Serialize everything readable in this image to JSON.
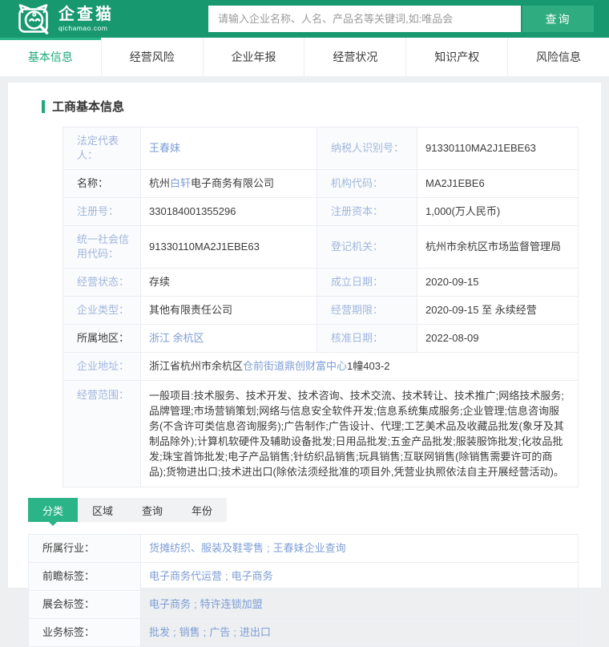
{
  "header": {
    "logo_title": "企查猫",
    "logo_subtitle": "qichamao.com",
    "search_placeholder": "请输入企业名称、人名、产品名等关键词,如:唯品会",
    "search_value": "",
    "search_button": "查询"
  },
  "nav": {
    "tabs": [
      {
        "label": "基本信息",
        "active": true
      },
      {
        "label": "经营风险",
        "active": false
      },
      {
        "label": "企业年报",
        "active": false
      },
      {
        "label": "经营状况",
        "active": false
      },
      {
        "label": "知识产权",
        "active": false
      },
      {
        "label": "风险信息",
        "active": false
      }
    ]
  },
  "section_title": "工商基本信息",
  "info": {
    "rows": [
      {
        "l1": "法定代表人：",
        "v1": "王春妹",
        "l2": "纳税人识别号：",
        "v2": "91330110MA2J1EBE63"
      },
      {
        "l1": "名称：",
        "v1_prefix": "杭州",
        "v1_highlight": "白轩",
        "v1_suffix": "电子商务有限公司",
        "l2": "机构代码：",
        "v2": "MA2J1EBE6"
      },
      {
        "l1": "注册号：",
        "v1": "330184001355296",
        "l2": "注册资本：",
        "v2": "1,000(万人民币)"
      },
      {
        "l1": "统一社会信用代码：",
        "v1": "91330110MA2J1EBE63",
        "l2": "登记机关：",
        "v2": "杭州市余杭区市场监督管理局"
      },
      {
        "l1": "经营状态：",
        "v1": "存续",
        "l2": "成立日期：",
        "v2": "2020-09-15"
      },
      {
        "l1": "企业类型：",
        "v1": "其他有限责任公司",
        "l2": "经营期限：",
        "v2": "2020-09-15 至 永续经营"
      },
      {
        "l1": "所属地区：",
        "v1": "浙江 余杭区",
        "l2": "核准日期：",
        "v2": "2022-08-09"
      }
    ],
    "address": {
      "label": "企业地址：",
      "prefix": "浙江省杭州市余杭区",
      "link": "仓前街道鼎创财富中心",
      "suffix": "1幢403-2"
    },
    "scope": {
      "label": "经营范围：",
      "text": "一般项目:技术服务、技术开发、技术咨询、技术交流、技术转让、技术推广;网络技术服务;品牌管理;市场营销策划;网络与信息安全软件开发;信息系统集成服务;企业管理;信息咨询服务(不含许可类信息咨询服务);广告制作;广告设计、代理;工艺美术品及收藏品批发(象牙及其制品除外);计算机软硬件及辅助设备批发;日用品批发;五金产品批发;服装服饰批发;化妆品批发;珠宝首饰批发;电子产品销售;针纺织品销售;玩具销售;互联网销售(除销售需要许可的商品);货物进出口;技术进出口(除依法须经批准的项目外,凭营业执照依法自主开展经营活动)。"
    }
  },
  "filter": {
    "tabs": [
      {
        "label": "分类",
        "active": true
      },
      {
        "label": "区域",
        "active": false
      },
      {
        "label": "查询",
        "active": false
      },
      {
        "label": "年份",
        "active": false
      }
    ]
  },
  "tags": {
    "separator": ";",
    "rows": [
      {
        "label": "所属行业：",
        "links": [
          "货摊纺织、服装及鞋零售",
          "王春妹企业查询"
        ]
      },
      {
        "label": "前瞻标签：",
        "links": [
          "电子商务代运营",
          "电子商务"
        ]
      },
      {
        "label": "展会标签：",
        "links": [
          "电子商务",
          "特许连锁加盟"
        ]
      },
      {
        "label": "业务标签：",
        "links": [
          "批发",
          "销售",
          "广告",
          "进出口"
        ]
      }
    ]
  },
  "colors": {
    "header_green": "#18986F",
    "button_green": "#2FAD80",
    "active_tab_green": "#1FA97A",
    "filter_active_green": "#2BB487",
    "label_blue": "#A0B6DE",
    "link_blue": "#7E9ED5"
  }
}
